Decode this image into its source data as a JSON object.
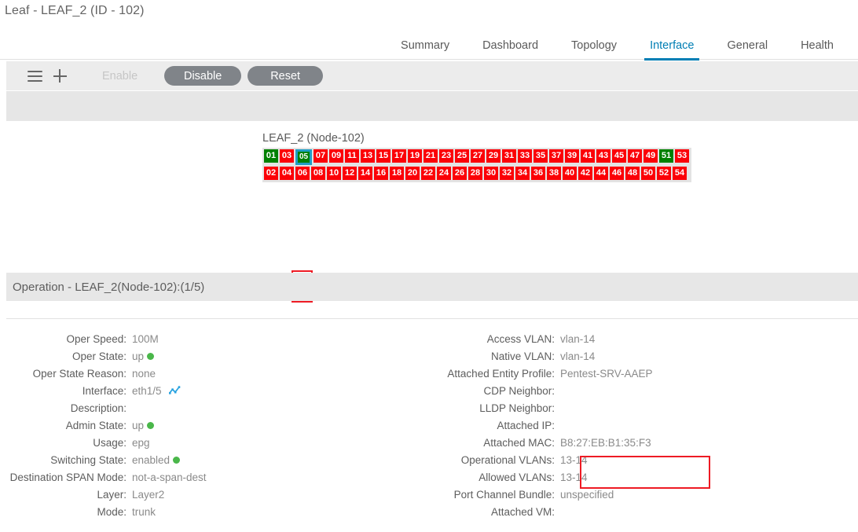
{
  "page": {
    "title": "Leaf - LEAF_2 (ID - 102)"
  },
  "tabs": [
    {
      "label": "Summary",
      "active": false
    },
    {
      "label": "Dashboard",
      "active": false
    },
    {
      "label": "Topology",
      "active": false
    },
    {
      "label": "Interface",
      "active": true
    },
    {
      "label": "General",
      "active": false
    },
    {
      "label": "Health",
      "active": false
    }
  ],
  "toolbar": {
    "menu_icon": "hamburger-menu-icon",
    "add_icon": "plus-icon",
    "enable_label": "Enable",
    "enable_disabled": true,
    "disable_label": "Disable",
    "reset_label": "Reset"
  },
  "port_panel": {
    "node_label": "LEAF_2 (Node-102)",
    "selected_port": "05",
    "colors": {
      "up": "#008000",
      "down": "#fb0007",
      "selection_ring": "#1f9ec4",
      "annotation": "#ee1b24"
    },
    "top_row": [
      {
        "n": "01",
        "state": "up"
      },
      {
        "n": "03",
        "state": "down"
      },
      {
        "n": "05",
        "state": "selected"
      },
      {
        "n": "07",
        "state": "down"
      },
      {
        "n": "09",
        "state": "down"
      },
      {
        "n": "11",
        "state": "down"
      },
      {
        "n": "13",
        "state": "down"
      },
      {
        "n": "15",
        "state": "down"
      },
      {
        "n": "17",
        "state": "down"
      },
      {
        "n": "19",
        "state": "down"
      },
      {
        "n": "21",
        "state": "down"
      },
      {
        "n": "23",
        "state": "down"
      },
      {
        "n": "25",
        "state": "down"
      },
      {
        "n": "27",
        "state": "down"
      },
      {
        "n": "29",
        "state": "down"
      },
      {
        "n": "31",
        "state": "down"
      },
      {
        "n": "33",
        "state": "down"
      },
      {
        "n": "35",
        "state": "down"
      },
      {
        "n": "37",
        "state": "down"
      },
      {
        "n": "39",
        "state": "down"
      },
      {
        "n": "41",
        "state": "down"
      },
      {
        "n": "43",
        "state": "down"
      },
      {
        "n": "45",
        "state": "down"
      },
      {
        "n": "47",
        "state": "down"
      },
      {
        "n": "49",
        "state": "down"
      },
      {
        "n": "51",
        "state": "up"
      },
      {
        "n": "53",
        "state": "down"
      }
    ],
    "bottom_row": [
      {
        "n": "02",
        "state": "down"
      },
      {
        "n": "04",
        "state": "down"
      },
      {
        "n": "06",
        "state": "down"
      },
      {
        "n": "08",
        "state": "down"
      },
      {
        "n": "10",
        "state": "down"
      },
      {
        "n": "12",
        "state": "down"
      },
      {
        "n": "14",
        "state": "down"
      },
      {
        "n": "16",
        "state": "down"
      },
      {
        "n": "18",
        "state": "down"
      },
      {
        "n": "20",
        "state": "down"
      },
      {
        "n": "22",
        "state": "down"
      },
      {
        "n": "24",
        "state": "down"
      },
      {
        "n": "26",
        "state": "down"
      },
      {
        "n": "28",
        "state": "down"
      },
      {
        "n": "30",
        "state": "down"
      },
      {
        "n": "32",
        "state": "down"
      },
      {
        "n": "34",
        "state": "down"
      },
      {
        "n": "36",
        "state": "down"
      },
      {
        "n": "38",
        "state": "down"
      },
      {
        "n": "40",
        "state": "down"
      },
      {
        "n": "42",
        "state": "down"
      },
      {
        "n": "44",
        "state": "down"
      },
      {
        "n": "46",
        "state": "down"
      },
      {
        "n": "48",
        "state": "down"
      },
      {
        "n": "50",
        "state": "down"
      },
      {
        "n": "52",
        "state": "down"
      },
      {
        "n": "54",
        "state": "down"
      }
    ]
  },
  "operation": {
    "header": "Operation - LEAF_2(Node-102):(1/5)"
  },
  "details": {
    "left": [
      {
        "label": "Oper Speed:",
        "value": "100M",
        "dot": false,
        "icon": null
      },
      {
        "label": "Oper State:",
        "value": "up",
        "dot": true,
        "icon": null
      },
      {
        "label": "Oper State Reason:",
        "value": "none",
        "dot": false,
        "icon": null
      },
      {
        "label": "Interface:",
        "value": "eth1/5",
        "dot": false,
        "icon": "statistics-chart-icon"
      },
      {
        "label": "Description:",
        "value": "",
        "dot": false,
        "icon": null
      },
      {
        "label": "Admin State:",
        "value": "up",
        "dot": true,
        "icon": null
      },
      {
        "label": "Usage:",
        "value": "epg",
        "dot": false,
        "icon": null
      },
      {
        "label": "Switching State:",
        "value": "enabled",
        "dot": true,
        "icon": null
      },
      {
        "label": "Destination SPAN Mode:",
        "value": "not-a-span-dest",
        "dot": false,
        "icon": null
      },
      {
        "label": "Layer:",
        "value": "Layer2",
        "dot": false,
        "icon": null
      },
      {
        "label": "Mode:",
        "value": "trunk",
        "dot": false,
        "icon": null
      }
    ],
    "right": [
      {
        "label": "Access VLAN:",
        "value": "vlan-14"
      },
      {
        "label": "Native VLAN:",
        "value": "vlan-14"
      },
      {
        "label": "Attached Entity Profile:",
        "value": "Pentest-SRV-AAEP"
      },
      {
        "label": "CDP Neighbor:",
        "value": ""
      },
      {
        "label": "LLDP Neighbor:",
        "value": ""
      },
      {
        "label": "Attached IP:",
        "value": ""
      },
      {
        "label": "Attached MAC:",
        "value": "B8:27:EB:B1:35:F3"
      },
      {
        "label": "Operational VLANs:",
        "value": "13-14"
      },
      {
        "label": "Allowed VLANs:",
        "value": "13-14"
      },
      {
        "label": "Port Channel Bundle:",
        "value": "unspecified"
      },
      {
        "label": "Attached VM:",
        "value": ""
      }
    ]
  }
}
